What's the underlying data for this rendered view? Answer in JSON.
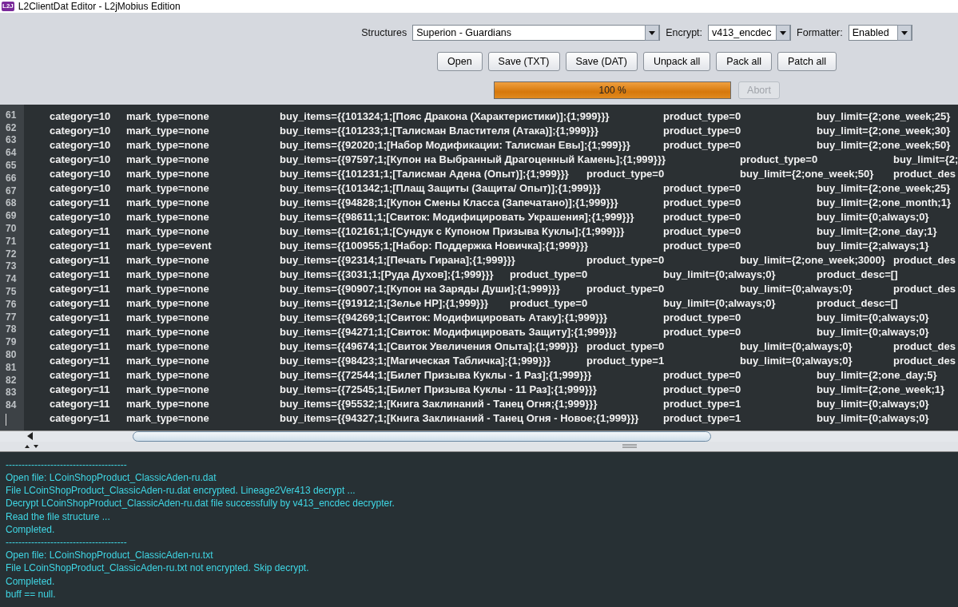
{
  "window": {
    "title": "L2ClientDat Editor - L2jMobius Edition",
    "icon_text": "L2J"
  },
  "toolbar": {
    "selectors": [
      {
        "label": "Structures",
        "value": "Superion - Guardians",
        "kind": "wide"
      },
      {
        "label": "Encrypt:",
        "value": "v413_encdec",
        "kind": "narrow"
      },
      {
        "label": "Formatter:",
        "value": "Enabled",
        "kind": "narrow"
      }
    ],
    "buttons": [
      "Open",
      "Save (TXT)",
      "Save (DAT)",
      "Unpack all",
      "Pack all",
      "Patch all"
    ],
    "progress": {
      "level": 1,
      "label": "100 %"
    },
    "abort": {
      "label": "Abort",
      "disabled": true
    }
  },
  "editor": {
    "line_numbers": [
      "61",
      "62",
      "63",
      "64",
      "65",
      "66",
      "67",
      "68",
      "69",
      "70",
      "71",
      "72",
      "73",
      "74",
      "75",
      "76",
      "77",
      "78",
      "79",
      "80",
      "81",
      "82",
      "83",
      "84"
    ],
    "lines": [
      {
        "fields": [
          "category=10",
          "mark_type=none",
          "buy_items={{101324;1;[Пояс Дракона (Характеристики)];{1;999}}}",
          "product_type=0",
          "buy_limit={2;one_week;25}"
        ]
      },
      {
        "fields": [
          "category=10",
          "mark_type=none",
          "buy_items={{101233;1;[Талисман Властителя (Атака)];{1;999}}}",
          "product_type=0",
          "buy_limit={2;one_week;30}"
        ]
      },
      {
        "fields": [
          "category=10",
          "mark_type=none",
          "buy_items={{92020;1;[Набор Модификации: Талисман Евы];{1;999}}}",
          "product_type=0",
          "buy_limit={2;one_week;50}"
        ]
      },
      {
        "fields": [
          "category=10",
          "mark_type=none",
          "buy_items={{97597;1;[Купон на Выбранный Драгоценный Камень];{1;999}}}",
          "product_type=0",
          "buy_limit={2;"
        ]
      },
      {
        "fields": [
          "category=10",
          "mark_type=none",
          "buy_items={{101231;1;[Талисман Адена (Опыт)];{1;999}}}",
          "product_type=0",
          "buy_limit={2;one_week;50}",
          "product_des"
        ]
      },
      {
        "fields": [
          "category=10",
          "mark_type=none",
          "buy_items={{101342;1;[Плащ Защиты (Защита/ Опыт)];{1;999}}}",
          "product_type=0",
          "buy_limit={2;one_week;25}"
        ]
      },
      {
        "fields": [
          "category=11",
          "mark_type=none",
          "buy_items={{94828;1;[Купон Смены Класса (Запечатано)];{1;999}}}",
          "product_type=0",
          "buy_limit={2;one_month;1}"
        ]
      },
      {
        "fields": [
          "category=10",
          "mark_type=none",
          "buy_items={{98611;1;[Свиток: Модифицировать Украшения];{1;999}}}",
          "product_type=0",
          "buy_limit={0;always;0}"
        ]
      },
      {
        "fields": [
          "category=11",
          "mark_type=none",
          "buy_items={{102161;1;[Сундук с Купоном Призыва Куклы];{1;999}}}",
          "product_type=0",
          "buy_limit={2;one_day;1}"
        ]
      },
      {
        "fields": [
          "category=11",
          "mark_type=event",
          "buy_items={{100955;1;[Набор: Поддержка Новичка];{1;999}}}",
          "product_type=0",
          "buy_limit={2;always;1}"
        ]
      },
      {
        "fields": [
          "category=11",
          "mark_type=none",
          "buy_items={{92314;1;[Печать Гирана];{1;999}}}",
          "product_type=0",
          "buy_limit={2;one_week;3000}",
          "product_des"
        ]
      },
      {
        "fields": [
          "category=11",
          "mark_type=none",
          "buy_items={{3031;1;[Руда Духов];{1;999}}}",
          "product_type=0",
          "buy_limit={0;always;0}",
          "product_desc=[]"
        ]
      },
      {
        "fields": [
          "category=11",
          "mark_type=none",
          "buy_items={{90907;1;[Купон на Заряды Души];{1;999}}}",
          "product_type=0",
          "buy_limit={0;always;0}",
          "product_des"
        ]
      },
      {
        "fields": [
          "category=11",
          "mark_type=none",
          "buy_items={{91912;1;[Зелье HP];{1;999}}}",
          "product_type=0",
          "buy_limit={0;always;0}",
          "product_desc=[]"
        ]
      },
      {
        "fields": [
          "category=11",
          "mark_type=none",
          "buy_items={{94269;1;[Свиток: Модифицировать Атаку];{1;999}}}",
          "product_type=0",
          "buy_limit={0;always;0}"
        ]
      },
      {
        "fields": [
          "category=11",
          "mark_type=none",
          "buy_items={{94271;1;[Свиток: Модифицировать Защиту];{1;999}}}",
          "product_type=0",
          "buy_limit={0;always;0}"
        ]
      },
      {
        "fields": [
          "category=11",
          "mark_type=none",
          "buy_items={{49674;1;[Свиток Увеличения Опыта];{1;999}}}",
          "product_type=0",
          "buy_limit={0;always;0}",
          "product_des"
        ]
      },
      {
        "fields": [
          "category=11",
          "mark_type=none",
          "buy_items={{98423;1;[Магическая Табличка];{1;999}}}",
          "product_type=1",
          "buy_limit={0;always;0}",
          "product_des"
        ]
      },
      {
        "fields": [
          "category=11",
          "mark_type=none",
          "buy_items={{72544;1;[Билет Призыва Куклы - 1 Раз];{1;999}}}",
          "product_type=0",
          "buy_limit={2;one_day;5}"
        ]
      },
      {
        "fields": [
          "category=11",
          "mark_type=none",
          "buy_items={{72545;1;[Билет Призыва Куклы - 11 Раз];{1;999}}}",
          "product_type=0",
          "buy_limit={2;one_week;1}"
        ]
      },
      {
        "fields": [
          "category=11",
          "mark_type=none",
          "buy_items={{95532;1;[Книга Заклинаний - Танец Огня;{1;999}}}",
          "product_type=1",
          "buy_limit={0;always;0}"
        ]
      },
      {
        "fields": [
          "category=11",
          "mark_type=none",
          "buy_items={{94327;1;[Книга Заклинаний - Танец Огня - Новое;{1;999}}}",
          "product_type=1",
          "buy_limit={0;always;0}"
        ]
      }
    ]
  },
  "log": {
    "lines": [
      "--------------------------------------",
      "Open file: LCoinShopProduct_ClassicAden-ru.dat",
      "File LCoinShopProduct_ClassicAden-ru.dat encrypted. Lineage2Ver413 decrypt ...",
      "Decrypt LCoinShopProduct_ClassicAden-ru.dat file successfully by v413_encdec decrypter.",
      "Read the file structure ...",
      "Completed.",
      "--------------------------------------",
      "Open file: LCoinShopProduct_ClassicAden-ru.txt",
      "File LCoinShopProduct_ClassicAden-ru.txt not encrypted. Skip decrypt.",
      "Completed.",
      "buff == null."
    ]
  }
}
